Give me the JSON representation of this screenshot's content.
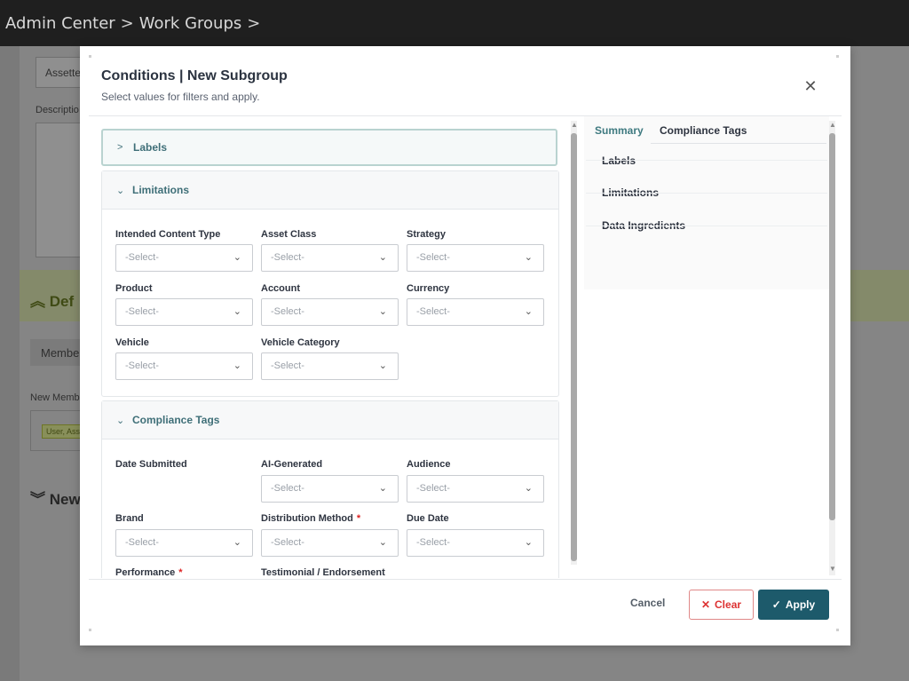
{
  "topbar": {
    "crumb1": "Admin Center",
    "crumb2": "Work Groups",
    "sep": ">"
  },
  "background": {
    "input_value": "Assette",
    "description_label": "Descriptio",
    "band_title": "Def",
    "tab_label": "Membe",
    "new_member_label": "New Memb",
    "tag_label": "User, Ass",
    "new_section": "New"
  },
  "modal": {
    "title": "Conditions | New Subgroup",
    "subtitle": "Select values for filters and apply."
  },
  "sections": {
    "labels_title": "Labels",
    "limitations_title": "Limitations",
    "compliance_title": "Compliance Tags"
  },
  "limitations": {
    "f1": "Intended Content Type",
    "f2": "Asset Class",
    "f3": "Strategy",
    "f4": "Product",
    "f5": "Account",
    "f6": "Currency",
    "f7": "Vehicle",
    "f8": "Vehicle Category"
  },
  "compliance": {
    "f1": "Date Submitted",
    "f2": "AI-Generated",
    "f3": "Audience",
    "f4": "Brand",
    "f5": "Distribution Method",
    "f6": "Due Date",
    "f7": "Performance",
    "f8": "Testimonial / Endorsement"
  },
  "select_placeholder": "-Select-",
  "summary": {
    "tab_summary": "Summary",
    "tab_compliance": "Compliance Tags",
    "item1": "Labels",
    "item2": "Limitations",
    "item3": "Data Ingredients"
  },
  "footer": {
    "cancel": "Cancel",
    "clear": "Clear",
    "apply": "Apply"
  },
  "colors": {
    "accent": "#1d5a6b",
    "danger": "#dd3333",
    "teal_text": "#3f6f78"
  }
}
